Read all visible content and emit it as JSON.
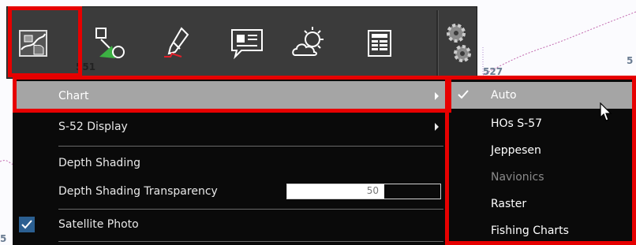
{
  "background": {
    "depth_labels": [
      "551",
      "527",
      "5",
      "5"
    ]
  },
  "toolbar": {
    "buttons": [
      {
        "name": "chart-layers-icon",
        "selected": true
      },
      {
        "name": "route-waypoint-icon",
        "selected": false
      },
      {
        "name": "boat-vessel-icon",
        "selected": false
      },
      {
        "name": "message-icon",
        "selected": false
      },
      {
        "name": "weather-icon",
        "selected": false
      },
      {
        "name": "data-panel-icon",
        "selected": false
      },
      {
        "name": "settings-gears-icon",
        "selected": false
      }
    ]
  },
  "menu": {
    "items": [
      {
        "label": "Chart",
        "has_submenu": true,
        "active": true
      },
      {
        "label": "S-52 Display",
        "has_submenu": true
      },
      {
        "label": "Depth Shading"
      },
      {
        "label": "Depth Shading Transparency",
        "slider_value": 50
      },
      {
        "label": "Satellite Photo",
        "checked": true
      }
    ]
  },
  "submenu": {
    "items": [
      {
        "label": "Auto",
        "checked": true,
        "active": true
      },
      {
        "label": "HOs S-57"
      },
      {
        "label": "Jeppesen"
      },
      {
        "label": "Navionics",
        "disabled": true
      },
      {
        "label": "Raster"
      },
      {
        "label": "Fishing Charts"
      }
    ]
  },
  "colors": {
    "highlight": "#e60000",
    "accent": "#2b5f91",
    "active_item": "#a5a5a5"
  }
}
